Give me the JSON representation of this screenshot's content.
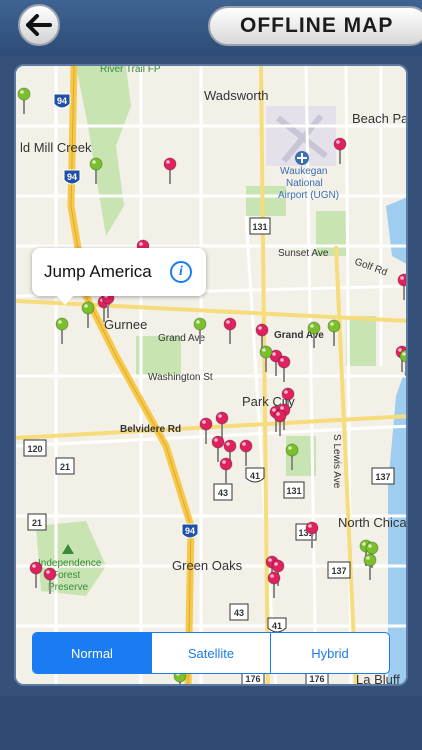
{
  "header": {
    "title": "OFFLINE MAP",
    "back_icon": "arrow-left-icon"
  },
  "map": {
    "callout": {
      "title": "Jump America",
      "info_icon": "info-icon"
    },
    "labels": {
      "wadsworth": "Wadsworth",
      "beach_park": "Beach Park",
      "old_mill_creek": "ld Mill Creek",
      "airport": [
        "Waukegan",
        "National",
        "Airport (UGN)"
      ],
      "sunset_ave": "Sunset Ave",
      "golf_rd": "Golf Rd",
      "gurnee": "Gurnee",
      "grand_ave_1": "Grand Ave",
      "grand_ave_2": "Grand Ave",
      "washington_st": "Washington St",
      "park_city": "Park City",
      "belvidere_rd": "Belvidere Rd",
      "s_lewis_ave": "S Lewis Ave",
      "north_chicago": "North Chica",
      "green_oaks": "Green Oaks",
      "independence_grove": [
        "Independence",
        "Forest",
        "Preserve"
      ],
      "lake_bluff": "La   Bluff",
      "river_trail": "River Trail FP"
    },
    "shields": {
      "i94_top": "94",
      "i94_mid": "94",
      "i94_bottom": "94",
      "il131_top": "131",
      "il131_mid": "131",
      "il131_low": "131",
      "il120": "120",
      "us21_a": "21",
      "us21_b": "21",
      "us41_a": "41",
      "us41_b": "41",
      "il43_a": "43",
      "il43_b": "43",
      "il137_a": "137",
      "il137_b": "137",
      "il176_a": "176",
      "il176_b": "176"
    },
    "colors": {
      "pin_pink": "#e0215f",
      "pin_green": "#7ac02a",
      "water": "#9fcdf0",
      "park": "#c7e4b2",
      "highway": "#f6c94b"
    }
  },
  "map_types": {
    "options": [
      "Normal",
      "Satellite",
      "Hybrid"
    ],
    "selected": "Normal"
  }
}
